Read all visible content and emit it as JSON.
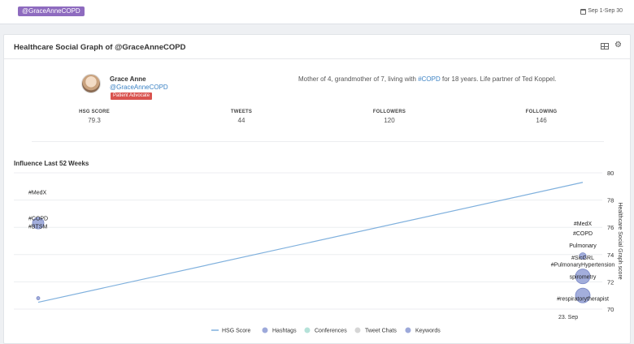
{
  "topbar": {
    "handle_badge": "@GraceAnneCOPD",
    "date_range": "Sep 1-Sep 30"
  },
  "panel": {
    "title": "Healthcare Social Graph of @GraceAnneCOPD"
  },
  "profile": {
    "name": "Grace Anne",
    "handle": "@GraceAnneCOPD",
    "role": "Patient Advocate",
    "bio_before": "Mother of 4, grandmother of 7, living with ",
    "bio_tag": "#COPD",
    "bio_after": " for 18 years. Life partner of Ted Koppel."
  },
  "stats": [
    {
      "label": "HSG SCORE",
      "value": "79.3"
    },
    {
      "label": "TWEETS",
      "value": "44"
    },
    {
      "label": "FOLLOWERS",
      "value": "120"
    },
    {
      "label": "FOLLOWING",
      "value": "146"
    }
  ],
  "influence": {
    "title": "Influence Last 52 Weeks"
  },
  "chart_data": {
    "type": "line",
    "ylabel": "Healthcare Social Graph score",
    "ylim": [
      70,
      80
    ],
    "yticks": [
      70,
      72,
      74,
      76,
      78,
      80
    ],
    "xtick_label": "23. Sep",
    "colors": {
      "hsg": "#7fb0dd",
      "hashtags": "#8c9ad3",
      "conferences": "#a8ddd2",
      "tweet_chats": "#cfcfcf",
      "keywords": "#8c9ad3"
    },
    "hsg_line": {
      "name": "HSG Score",
      "start": [
        0.0,
        70.5
      ],
      "end": [
        1.0,
        79.3
      ]
    },
    "hashtag_bubbles": [
      {
        "t": 0.0,
        "y": 76.3,
        "r": 7
      },
      {
        "t": 0.0,
        "y": 70.8,
        "r": 2
      },
      {
        "t": 1.0,
        "y": 72.4,
        "r": 9
      },
      {
        "t": 1.0,
        "y": 71.0,
        "r": 9
      },
      {
        "t": 1.0,
        "y": 73.9,
        "r": 4
      }
    ],
    "annotations": [
      {
        "t": 0.0,
        "y": 78.6,
        "text": "#MedX",
        "align": "start"
      },
      {
        "t": 0.0,
        "y": 76.7,
        "text": "#COPD",
        "align": "start"
      },
      {
        "t": 0.0,
        "y": 76.1,
        "text": "#BTSM",
        "align": "start"
      },
      {
        "t": 1.0,
        "y": 76.3,
        "text": "#MedX",
        "align": "center"
      },
      {
        "t": 1.0,
        "y": 75.6,
        "text": "#COPD",
        "align": "center"
      },
      {
        "t": 1.0,
        "y": 74.7,
        "text": "Pulmonary",
        "align": "center"
      },
      {
        "t": 1.0,
        "y": 73.8,
        "text": "#SicGRL",
        "align": "center"
      },
      {
        "t": 1.0,
        "y": 73.3,
        "text": "#PulmonaryHypertension",
        "align": "center"
      },
      {
        "t": 1.0,
        "y": 72.4,
        "text": "spirometry",
        "align": "center"
      },
      {
        "t": 1.0,
        "y": 70.8,
        "text": "#respiratorytherapist",
        "align": "center"
      }
    ],
    "legend": [
      {
        "name": "HSG Score",
        "kind": "line",
        "color": "#7fb0dd"
      },
      {
        "name": "Hashtags",
        "kind": "dot",
        "color": "#8c9ad3"
      },
      {
        "name": "Conferences",
        "kind": "dot",
        "color": "#a8ddd2"
      },
      {
        "name": "Tweet Chats",
        "kind": "dot",
        "color": "#cfcfcf"
      },
      {
        "name": "Keywords",
        "kind": "dot",
        "color": "#8c9ad3"
      }
    ],
    "legend_position": "bottom"
  }
}
